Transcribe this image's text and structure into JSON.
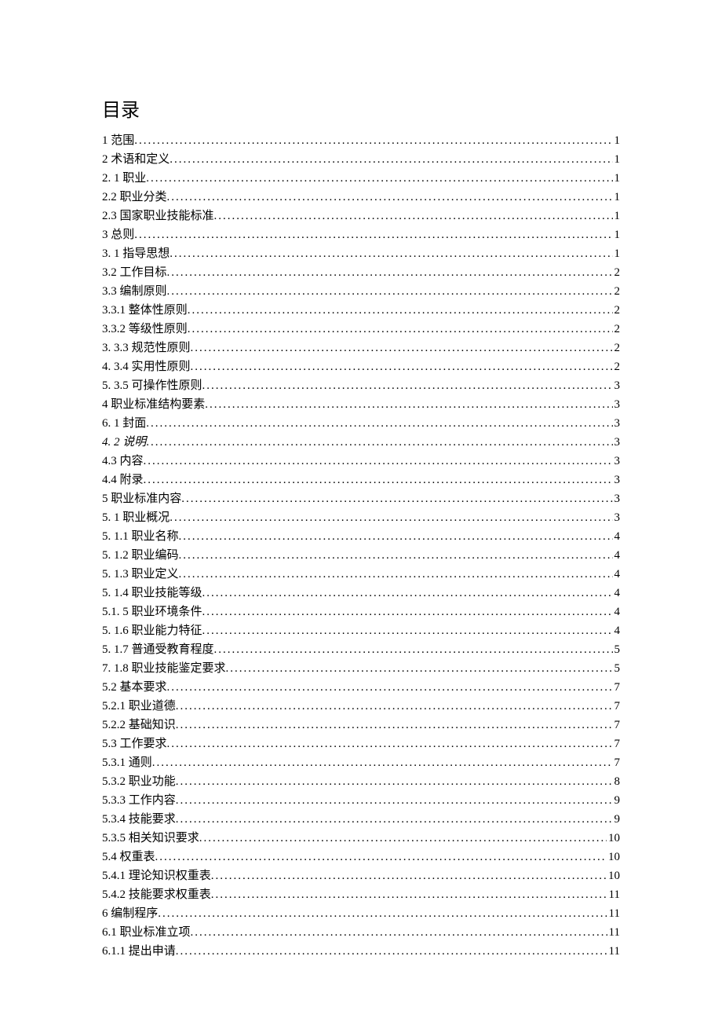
{
  "title": "目录",
  "entries": [
    {
      "label": "1 范围",
      "page": "1"
    },
    {
      "label": "2 术语和定义",
      "page": "1"
    },
    {
      "label": "2.   1 职业",
      "page": "1"
    },
    {
      "label": "2.2      职业分类",
      "page": "1"
    },
    {
      "label": "2.3     国家职业技能标准",
      "page": "1"
    },
    {
      "label": "3 总则",
      "page": "1"
    },
    {
      "label": "3.   1 指导思想",
      "page": "1"
    },
    {
      "label": "3.2      工作目标",
      "page": "2"
    },
    {
      "label": "3.3     编制原则",
      "page": "2"
    },
    {
      "label": "3.3.1     整体性原则",
      "page": "2"
    },
    {
      "label": "3.3.2       等级性原则",
      "page": "2"
    },
    {
      "label": "3.   3.3  规范性原则",
      "page": "2"
    },
    {
      "label": "4.   3.4  实用性原则",
      "page": "2"
    },
    {
      "label": "5.   3.5 可操作性原则",
      "page": "3"
    },
    {
      "label": "4 职业标准结构要素",
      "page": "3"
    },
    {
      "label": "6.   1 封面",
      "page": "3"
    },
    {
      "label": "4. 2 说明",
      "page": "3",
      "italic": true
    },
    {
      "label": "4.3 内容",
      "page": "3"
    },
    {
      "label": "4.4 附录",
      "page": "3"
    },
    {
      "label": "5 职业标准内容",
      "page": "3"
    },
    {
      "label": "5.   1 职业概况",
      "page": "3"
    },
    {
      "label": "5.   1.1 职业名称",
      "page": "4"
    },
    {
      "label": "5.   1.2 职业编码",
      "page": "4"
    },
    {
      "label": "5.   1.3 职业定义",
      "page": "4"
    },
    {
      "label": "5.   1.4 职业技能等级",
      "page": "4"
    },
    {
      "label": "5.1.   5 职业环境条件",
      "page": "4"
    },
    {
      "label": "5.   1.6 职业能力特征",
      "page": "4"
    },
    {
      "label": "5.   1.7 普通受教育程度",
      "page": "5"
    },
    {
      "label": "7.   1.8 职业技能鉴定要求",
      "page": "5"
    },
    {
      "label": "5.2 基本要求",
      "page": "7"
    },
    {
      "label": "5.2.1 职业道德",
      "page": "7"
    },
    {
      "label": "5.2.2 基础知识",
      "page": "7"
    },
    {
      "label": "5.3 工作要求",
      "page": "7"
    },
    {
      "label": "5.3.1    通则",
      "page": "7"
    },
    {
      "label": "5.3.2 职业功能",
      "page": "8"
    },
    {
      "label": "5.3.3    工作内容",
      "page": "9"
    },
    {
      "label": "5.3.4    技能要求",
      "page": "9"
    },
    {
      "label": "5.3.5 相关知识要求",
      "page": "10"
    },
    {
      "label": "5.4 权重表",
      "page": "10"
    },
    {
      "label": "5.4.1 理论知识权重表",
      "page": "10"
    },
    {
      "label": "5.4.2 技能要求权重表",
      "page": "11"
    },
    {
      "label": "6 编制程序",
      "page": "11"
    },
    {
      "label": "6.1 职业标准立项",
      "page": "11"
    },
    {
      "label": "6.1.1 提出申请",
      "page": "11"
    }
  ]
}
